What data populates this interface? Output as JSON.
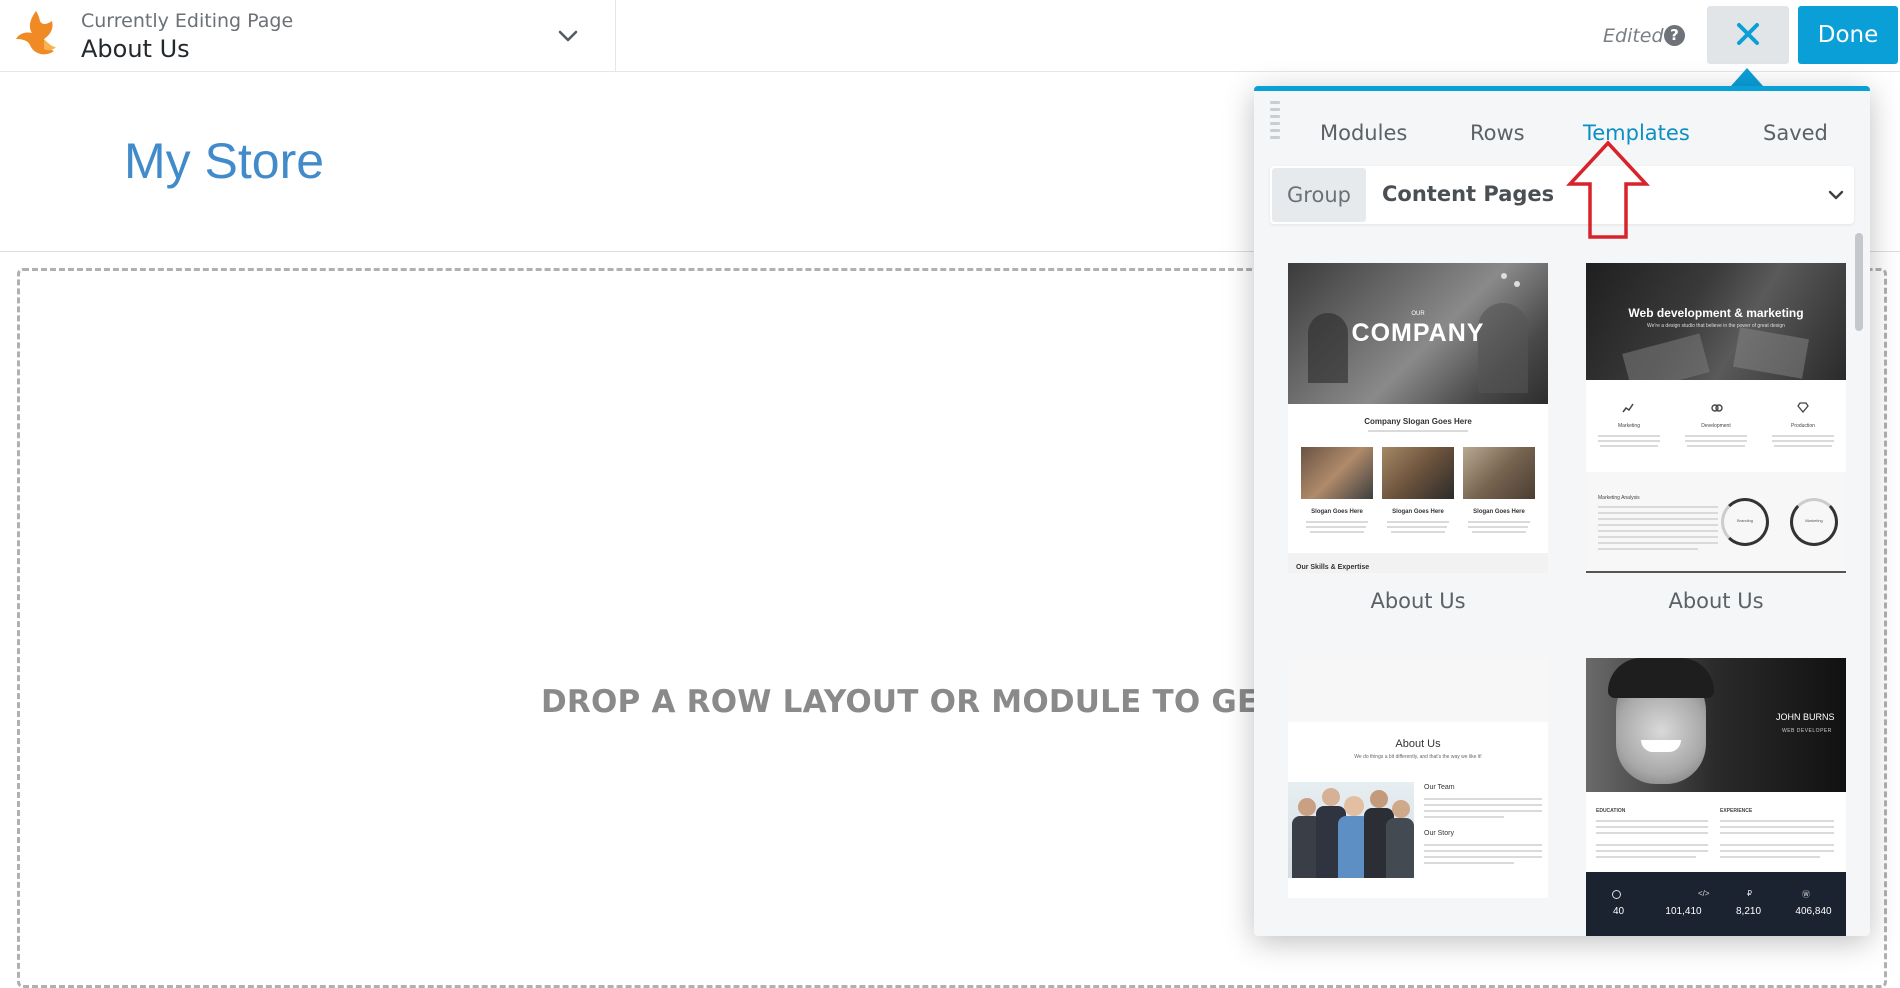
{
  "topbar": {
    "editing_label": "Currently Editing Page",
    "page_title": "About Us",
    "edited_status": "Edited",
    "help_icon": "?",
    "done_label": "Done"
  },
  "page": {
    "site_title": "My Store",
    "drop_message": "DROP A ROW LAYOUT OR MODULE TO GET STA"
  },
  "panel": {
    "tabs": [
      {
        "label": "Modules",
        "active": false
      },
      {
        "label": "Rows",
        "active": false
      },
      {
        "label": "Templates",
        "active": true
      },
      {
        "label": "Saved",
        "active": false
      }
    ],
    "group": {
      "label": "Group",
      "value": "Content Pages"
    },
    "templates": [
      {
        "label": "About Us",
        "thumb": {
          "small_heading": "OUR",
          "heading": "COMPANY",
          "slogan": "Company Slogan Goes Here",
          "columns": [
            "Slogan Goes Here",
            "Slogan Goes Here",
            "Slogan Goes Here"
          ],
          "footer": "Our Skills & Expertise"
        }
      },
      {
        "label": "About Us",
        "thumb": {
          "heading": "Web development & marketing",
          "subheading": "We're a design studio that believe in the power of great design",
          "columns": [
            "Marketing",
            "Development",
            "Production"
          ],
          "analysis": "Marketing Analysis",
          "circles": [
            "Branding",
            "Marketing"
          ]
        }
      },
      {
        "thumb": {
          "heading": "About Us",
          "subheading": "We do things a bit differently, and that's the way we like it!",
          "section_one": "Our Team",
          "section_two": "Our Story"
        }
      },
      {
        "thumb": {
          "name": "JOHN BURNS",
          "role": "WEB DEVELOPER",
          "col_one": "EDUCATION",
          "col_two": "EXPERIENCE",
          "stats": [
            "40",
            "101,410",
            "8,210",
            "406,840"
          ]
        }
      }
    ]
  },
  "colors": {
    "accent": "#0b9fd8",
    "site_title": "#428bca",
    "annotation_arrow": "#d9232a"
  }
}
